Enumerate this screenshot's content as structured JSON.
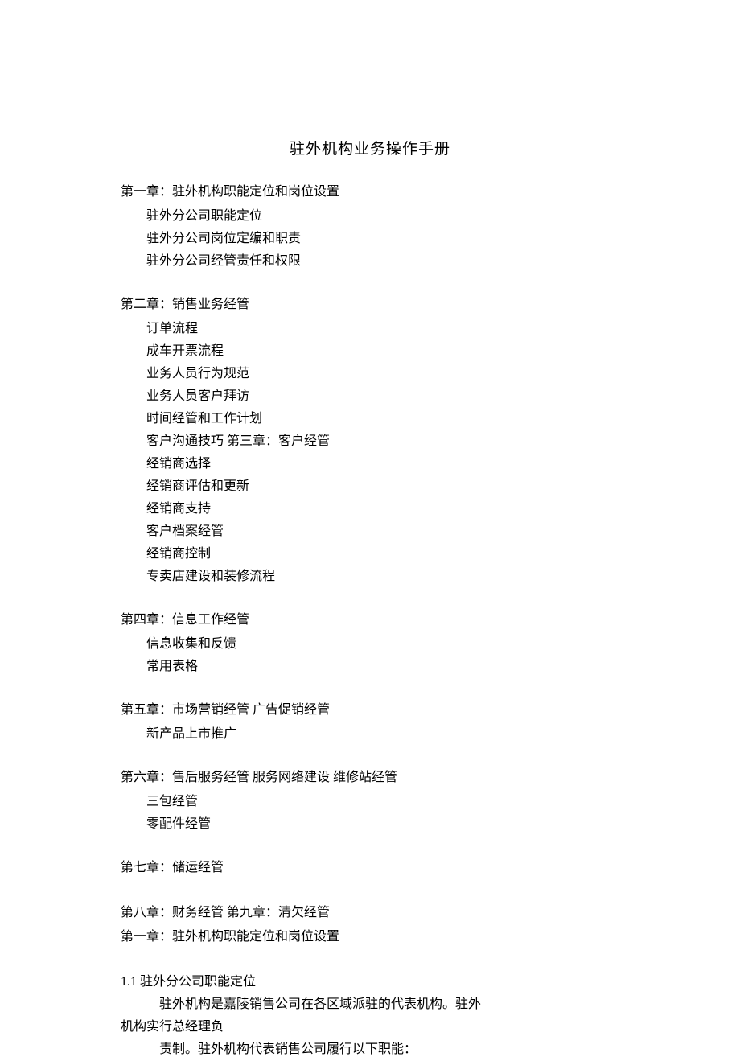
{
  "title": "驻外机构业务操作手册",
  "chapter1": {
    "heading": "第一章：驻外机构职能定位和岗位设置",
    "items": [
      "驻外分公司职能定位",
      "驻外分公司岗位定编和职责",
      "驻外分公司经管责任和权限"
    ]
  },
  "chapter2": {
    "heading": "第二章：销售业务经管",
    "items": [
      "订单流程",
      "成车开票流程",
      "业务人员行为规范",
      "业务人员客户拜访",
      "时间经管和工作计划",
      "客户沟通技巧 第三章：客户经管",
      "经销商选择",
      "经销商评估和更新",
      "经销商支持",
      "客户档案经管",
      "经销商控制",
      "专卖店建设和装修流程"
    ]
  },
  "chapter4": {
    "heading": "第四章：信息工作经管",
    "items": [
      "信息收集和反馈",
      "常用表格"
    ]
  },
  "chapter5": {
    "heading": "第五章：市场营销经管 广告促销经管",
    "items": [
      "新产品上市推广"
    ]
  },
  "chapter6": {
    "heading": "第六章：售后服务经管 服务网络建设 维修站经管",
    "items": [
      "三包经管",
      "零配件经管"
    ]
  },
  "chapter7": {
    "heading": "第七章：储运经管"
  },
  "chapter8": {
    "heading": "第八章：财务经管 第九章：清欠经管"
  },
  "chapter1repeat": {
    "heading": "第一章：驻外机构职能定位和岗位设置"
  },
  "section1_1": {
    "heading": "1.1 驻外分公司职能定位",
    "para1": "驻外机构是嘉陵销售公司在各区域派驻的代表机构。驻外",
    "para2": "机构实行总经理负",
    "para3": "责制。驻外机构代表销售公司履行以下职能："
  }
}
